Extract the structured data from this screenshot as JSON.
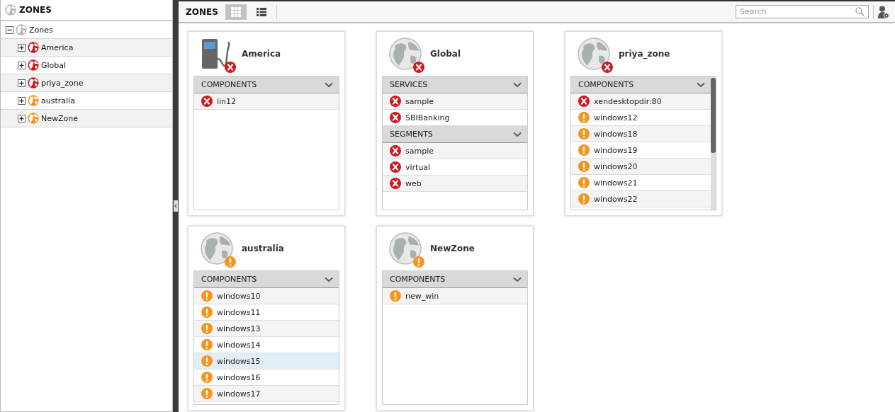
{
  "sidebar": {
    "title": "ZONES",
    "tree": {
      "label": "Zones",
      "expanded": true,
      "children": [
        {
          "label": "America",
          "color": "#d0181e",
          "expanded": false
        },
        {
          "label": "Global",
          "color": "#d0181e",
          "expanded": false
        },
        {
          "label": "priya_zone",
          "color": "#d0181e",
          "expanded": false
        },
        {
          "label": "australia",
          "color": "#f7941d",
          "expanded": false
        },
        {
          "label": "NewZone",
          "color": "#f7941d",
          "expanded": false
        }
      ]
    }
  },
  "toolbar": {
    "title": "ZONES",
    "views": [
      {
        "kind": "grid",
        "selected": true
      },
      {
        "kind": "list",
        "selected": false
      }
    ],
    "search": {
      "placeholder": "Search"
    }
  },
  "zones": [
    {
      "name": "America",
      "kind": "pump",
      "badge": {
        "kind": "error"
      },
      "scrollable": false,
      "sections": [
        {
          "title": "COMPONENTS",
          "items": [
            {
              "label": "lin12",
              "kind": "error",
              "selected": false
            }
          ]
        }
      ]
    },
    {
      "name": "Global",
      "kind": "globe",
      "badge": {
        "kind": "error"
      },
      "scrollable": false,
      "sections": [
        {
          "title": "SERVICES",
          "items": [
            {
              "label": "sample",
              "kind": "error",
              "selected": false
            },
            {
              "label": "SBIBanking",
              "kind": "error",
              "selected": false
            }
          ]
        },
        {
          "title": "SEGMENTS",
          "items": [
            {
              "label": "sample",
              "kind": "error",
              "selected": false
            },
            {
              "label": "virtual",
              "kind": "error",
              "selected": false
            },
            {
              "label": "web",
              "kind": "error",
              "selected": false
            }
          ]
        }
      ]
    },
    {
      "name": "priya_zone",
      "kind": "globe",
      "badge": {
        "kind": "error"
      },
      "scrollable": true,
      "sections": [
        {
          "title": "COMPONENTS",
          "items": [
            {
              "label": "xendesktopdir:80",
              "kind": "error",
              "selected": false
            },
            {
              "label": "windows12",
              "kind": "warning",
              "selected": false
            },
            {
              "label": "windows18",
              "kind": "warning",
              "selected": false
            },
            {
              "label": "windows19",
              "kind": "warning",
              "selected": false
            },
            {
              "label": "windows20",
              "kind": "warning",
              "selected": false
            },
            {
              "label": "windows21",
              "kind": "warning",
              "selected": false
            },
            {
              "label": "windows22",
              "kind": "warning",
              "selected": false
            }
          ]
        }
      ]
    },
    {
      "name": "australia",
      "kind": "globe",
      "badge": {
        "kind": "warning"
      },
      "scrollable": false,
      "sections": [
        {
          "title": "COMPONENTS",
          "items": [
            {
              "label": "windows10",
              "kind": "warning",
              "selected": false
            },
            {
              "label": "windows11",
              "kind": "warning",
              "selected": false
            },
            {
              "label": "windows13",
              "kind": "warning",
              "selected": false
            },
            {
              "label": "windows14",
              "kind": "warning",
              "selected": false
            },
            {
              "label": "windows15",
              "kind": "warning",
              "selected": true
            },
            {
              "label": "windows16",
              "kind": "warning",
              "selected": false
            },
            {
              "label": "windows17",
              "kind": "warning",
              "selected": false
            }
          ]
        }
      ]
    },
    {
      "name": "NewZone",
      "kind": "globe",
      "badge": {
        "kind": "warning"
      },
      "scrollable": false,
      "sections": [
        {
          "title": "COMPONENTS",
          "items": [
            {
              "label": "new_win",
              "kind": "warning",
              "selected": false
            }
          ]
        }
      ]
    }
  ]
}
